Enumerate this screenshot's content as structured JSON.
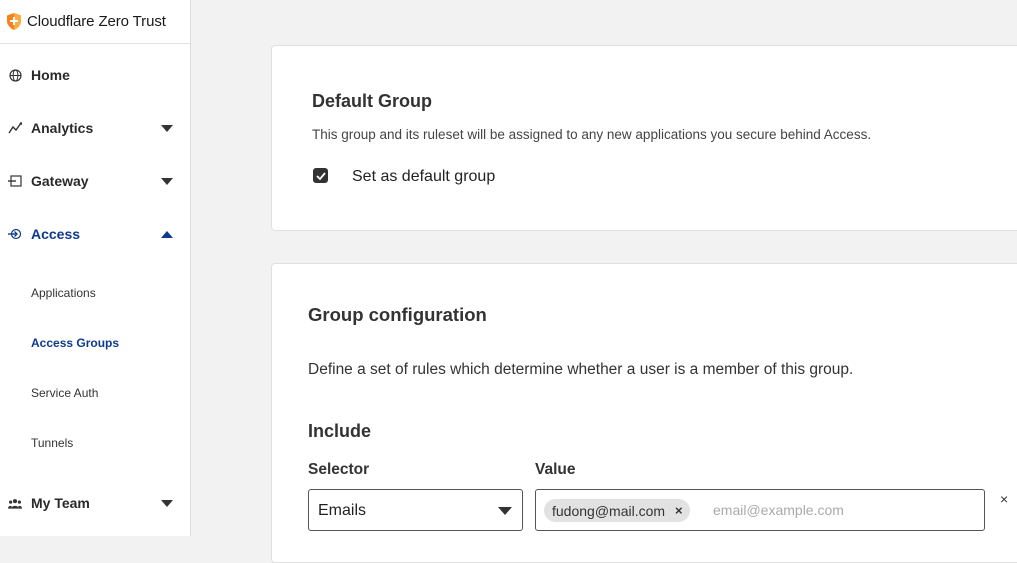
{
  "brand": {
    "name": "Cloudflare Zero Trust",
    "logo_icon": "cloudflare-shield-logo",
    "logo_color": "#f6821f"
  },
  "sidebar": {
    "items": [
      {
        "label": "Home",
        "icon": "globe-icon"
      },
      {
        "label": "Analytics",
        "icon": "analytics-icon"
      },
      {
        "label": "Gateway",
        "icon": "gateway-icon"
      },
      {
        "label": "Access",
        "icon": "access-icon"
      },
      {
        "label": "My Team",
        "icon": "team-icon"
      }
    ],
    "access_subitems": [
      "Applications",
      "Access Groups",
      "Service Auth",
      "Tunnels"
    ],
    "active_color": "#0e3a8c"
  },
  "default_group": {
    "title": "Default Group",
    "description": "This group and its ruleset will be assigned to any new applications you secure behind Access.",
    "checkbox_label": "Set as default group",
    "checked": true
  },
  "group_config": {
    "title": "Group configuration",
    "description": "Define a set of rules which determine whether a user is a member of this group.",
    "include_title": "Include",
    "selector_label": "Selector",
    "value_label": "Value",
    "selector_value": "Emails",
    "tag_value": "fudong@mail.com",
    "tag_remove": "×",
    "value_placeholder": "email@example.com",
    "row_remove": "×"
  }
}
